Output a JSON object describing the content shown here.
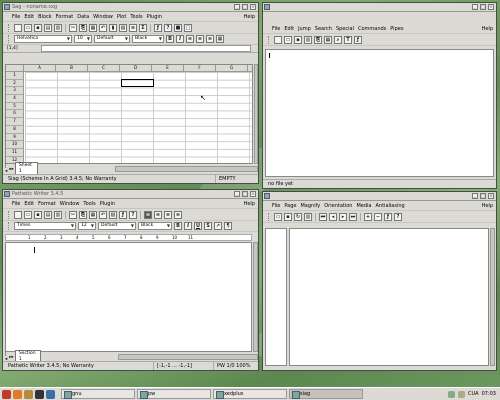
{
  "desktop": {
    "accent": "#6f9a62"
  },
  "gnumeric": {
    "title": "Sag - noname.sxg",
    "menu": [
      "File",
      "Edit",
      "Block",
      "Format",
      "Data",
      "Window",
      "Plot",
      "Tools",
      "Plugin"
    ],
    "help": "Help",
    "font": "Helvetica",
    "size": "10",
    "style": "Default",
    "color": "Black",
    "cellref": "[1,4]",
    "columns": [
      "A",
      "B",
      "C",
      "D",
      "E",
      "F",
      "G"
    ],
    "rows": [
      "1",
      "2",
      "3",
      "4",
      "5",
      "6",
      "7",
      "8",
      "9",
      "10",
      "11",
      "12"
    ],
    "sheet_tab": "Sheet 1",
    "status_left": "Siag (Scheme In A Grid) 3.4.5; No Warranty",
    "status_right": "EMPTY"
  },
  "egypt": {
    "menu": [
      "File",
      "Edit",
      "Jump",
      "Search",
      "Special",
      "Commands",
      "Pipes"
    ],
    "help": "Help",
    "status": "no file yet"
  },
  "pw": {
    "title": "Pathetic Writer 3.4.5",
    "menu": [
      "File",
      "Edit",
      "Format",
      "Window",
      "Tools",
      "Plugin"
    ],
    "help": "Help",
    "font": "Times",
    "size": "12",
    "style": "Default",
    "color": "Black",
    "ruler": [
      "1",
      "2",
      "3",
      "4",
      "5",
      "6",
      "7",
      "8",
      "9",
      "10",
      "11"
    ],
    "section_tab": "Section 1",
    "status_left": "Pathetic Writer 3.4.5; No Warranty",
    "status_mid": "[-1,-1 ... -1,-1]",
    "status_right": "PW 1/0 100%"
  },
  "xedplus": {
    "menu": [
      "File",
      "Page",
      "Magnify",
      "Orientation",
      "Media",
      "Antialiasing"
    ],
    "help": "Help"
  },
  "taskbar": {
    "tasks": [
      "gnu",
      "pw",
      "xedplus",
      "siag"
    ],
    "locale": "CUA",
    "clock": "07:03"
  }
}
